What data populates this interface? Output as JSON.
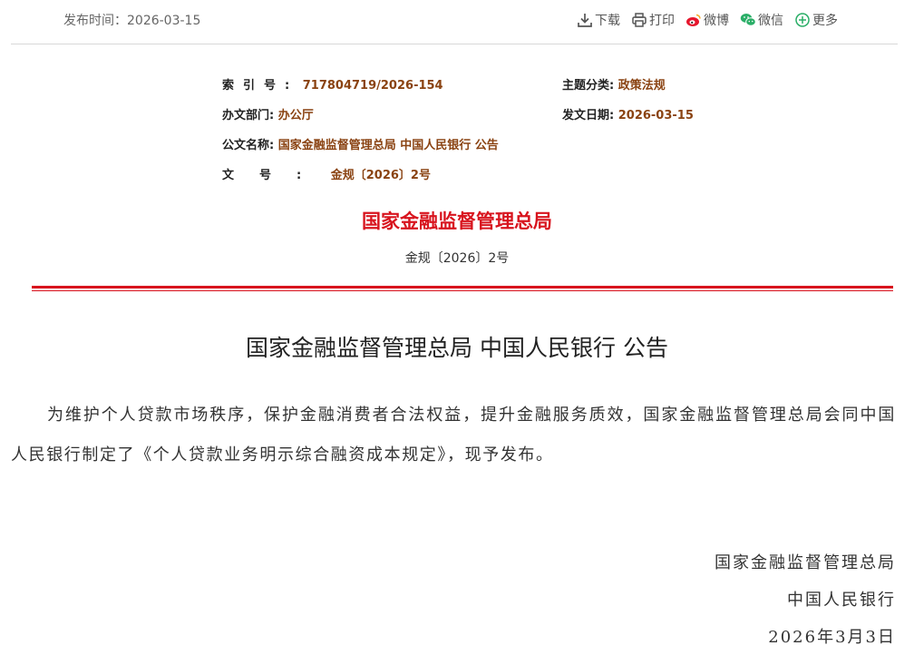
{
  "header": {
    "publish_time": "发布时间：2026-03-15",
    "tools": [
      {
        "label": "下载",
        "icon": "download-icon"
      },
      {
        "label": "打印",
        "icon": "print-icon"
      },
      {
        "label": "微博",
        "icon": "weibo-icon"
      },
      {
        "label": "微信",
        "icon": "wechat-icon"
      },
      {
        "label": "更多",
        "icon": "plus-icon"
      }
    ]
  },
  "meta": {
    "index_label": "索引号:",
    "index_value": "717804719/2026-154",
    "topic_label": "主题分类:",
    "topic_value": "政策法规",
    "dept_label": "办文部门:",
    "dept_value": "办公厅",
    "date_label": "发文日期:",
    "date_value": "2026-03-15",
    "name_label": "公文名称:",
    "name_value": "国家金融监督管理总局 中国人民银行 公告",
    "docno_label": "文号:",
    "docno_value": "金规〔2026〕2号"
  },
  "document": {
    "issuer": "国家金融监督管理总局",
    "doc_number": "金规〔2026〕2号",
    "title": "国家金融监督管理总局 中国人民银行 公告",
    "body": "为维护个人贷款市场秩序，保护金融消费者合法权益，提升金融服务质效，国家金融监督管理总局会同中国人民银行制定了《个人贷款业务明示综合融资成本规定》，现予发布。",
    "signatories": [
      "国家金融监督管理总局",
      "中国人民银行"
    ],
    "sign_date": "2026年3月3日"
  },
  "colors": {
    "accent_red": "#d8141e",
    "meta_value": "#8a4312",
    "weibo": "#e6162d",
    "wechat": "#2aae67"
  }
}
